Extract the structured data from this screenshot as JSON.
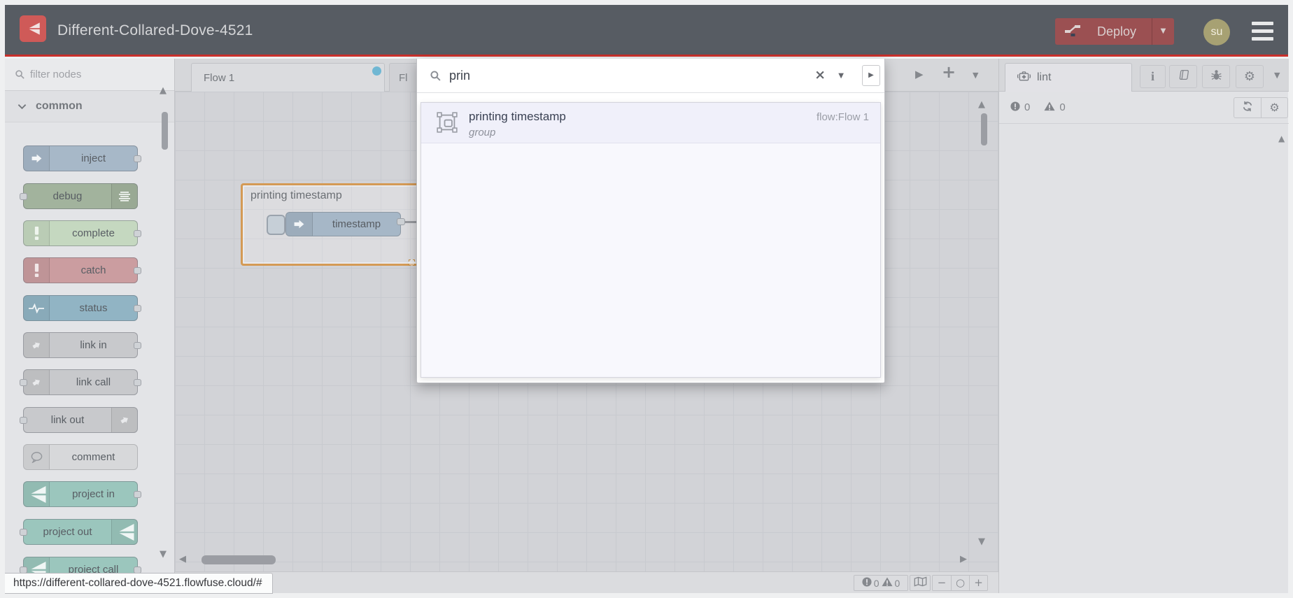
{
  "header": {
    "title": "Different-Collared-Dove-4521",
    "deploy_label": "Deploy",
    "avatar_initials": "su"
  },
  "palette": {
    "filter_placeholder": "filter nodes",
    "category_label": "common",
    "nodes": [
      {
        "label": "inject",
        "color": "#a7b8c8",
        "icon": "inject-arrow",
        "icon_color": "#f4f6f8",
        "icon_side": "left",
        "ports": "right"
      },
      {
        "label": "debug",
        "color": "#a2b39d",
        "icon": "debug-lines",
        "icon_color": "#eef2ee",
        "icon_side": "right",
        "ports": "left"
      },
      {
        "label": "complete",
        "color": "#c5d8c0",
        "icon": "exclamation",
        "icon_color": "#eff5ee",
        "icon_side": "left",
        "ports": "right"
      },
      {
        "label": "catch",
        "color": "#cb9da0",
        "icon": "exclamation",
        "icon_color": "#f2e7e8",
        "icon_side": "left",
        "ports": "right"
      },
      {
        "label": "status",
        "color": "#91b4c4",
        "icon": "pulse",
        "icon_color": "#f0f4f6",
        "icon_side": "left",
        "ports": "right"
      },
      {
        "label": "link in",
        "color": "#c8c9cc",
        "icon": "link-arrow",
        "icon_color": "#e9eaec",
        "icon_side": "left",
        "ports": "right"
      },
      {
        "label": "link call",
        "color": "#c8c9cc",
        "icon": "link-arrow",
        "icon_color": "#e9eaec",
        "icon_side": "left",
        "ports": "both"
      },
      {
        "label": "link out",
        "color": "#c8c9cc",
        "icon": "link-arrow",
        "icon_color": "#e9eaec",
        "icon_side": "right",
        "ports": "left"
      },
      {
        "label": "comment",
        "color": "#d7d8da",
        "icon": "comment-bubble",
        "icon_color": "#95989d",
        "icon_side": "left",
        "ports": "none"
      },
      {
        "label": "project in",
        "color": "#9bc6bd",
        "icon": "flowfuse",
        "icon_color": "#f0f6f5",
        "icon_side": "left",
        "ports": "right"
      },
      {
        "label": "project out",
        "color": "#9bc6bd",
        "icon": "flowfuse",
        "icon_color": "#f0f6f5",
        "icon_side": "right",
        "ports": "left"
      },
      {
        "label": "project call",
        "color": "#9bc6bd",
        "icon": "flowfuse",
        "icon_color": "#f0f6f5",
        "icon_side": "left",
        "ports": "both"
      }
    ]
  },
  "workspace": {
    "active_tab": "Flow 1",
    "partial_tab": "Fl"
  },
  "canvas": {
    "group_label": "printing timestamp",
    "inject_node_label": "timestamp"
  },
  "search_dialog": {
    "query": "prin",
    "result": {
      "title": "printing timestamp",
      "type_label": "group",
      "location": "flow:Flow 1"
    }
  },
  "sidebar": {
    "tab_label": "lint",
    "error_count": "0",
    "warning_count": "0"
  },
  "canvas_footer": {
    "error_count": "0",
    "warning_count": "0"
  },
  "status_bar": {
    "url": "https://different-collared-dove-4521.flowfuse.cloud/#"
  },
  "glyphs": {
    "close": "×",
    "caret_down": "▼",
    "caret_right": "▶",
    "play": "▶",
    "add": "+",
    "scroll_up": "▲",
    "scroll_down": "▼",
    "scroll_left": "◀",
    "scroll_right": "▶",
    "zoom_out": "−",
    "zoom_reset": "○",
    "zoom_in": "+",
    "gear": "⚙",
    "info": "i"
  },
  "colors": {
    "header_bg": "#575c63",
    "brand_red": "#cf5a58",
    "deploy_bg": "#9b5052",
    "red_line": "#c9302b",
    "dirty_dot": "#70b7d3",
    "group_selected": "#d49a55",
    "canvas_bg": "#d2d3d7"
  }
}
